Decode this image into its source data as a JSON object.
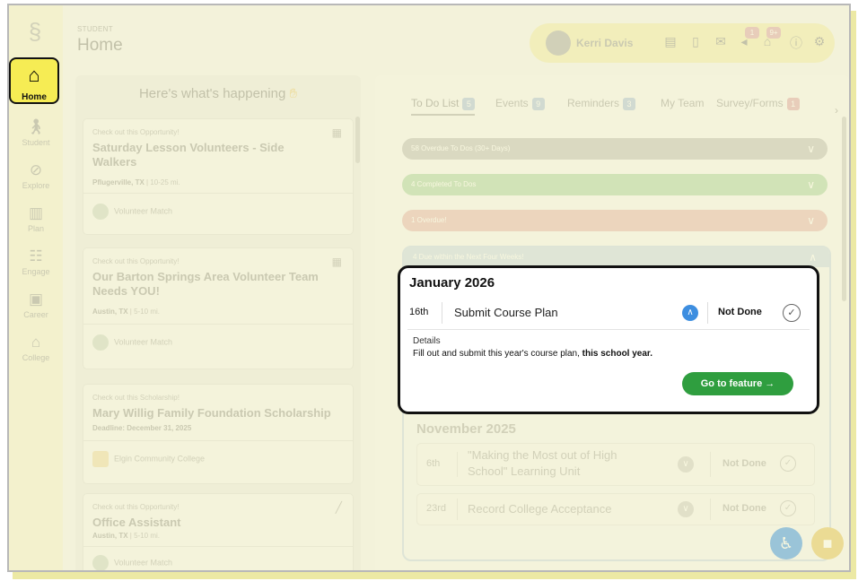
{
  "sidebar": {
    "items": [
      {
        "label": "Home",
        "icon": "home-icon"
      },
      {
        "label": "Student",
        "icon": "student-icon"
      },
      {
        "label": "Explore",
        "icon": "compass-icon"
      },
      {
        "label": "Plan",
        "icon": "map-icon"
      },
      {
        "label": "Engage",
        "icon": "handshake-icon"
      },
      {
        "label": "Career",
        "icon": "briefcase-icon"
      },
      {
        "label": "College",
        "icon": "college-icon"
      }
    ]
  },
  "header": {
    "section": "STUDENT",
    "title": "Home",
    "user_name": "Kerri Davis",
    "notif_badge_1": "1",
    "notif_badge_2": "9+"
  },
  "feed": {
    "title": "Here's what's happening",
    "cards": [
      {
        "kicker": "Check out this Opportunity!",
        "title": "Saturday Lesson Volunteers - Side Walkers",
        "meta_bold": "Pflugerville, TX",
        "meta_rest": " | 10-25 mi.",
        "source": "Volunteer Match"
      },
      {
        "kicker": "Check out this Opportunity!",
        "title": "Our Barton Springs Area Volunteer Team Needs YOU!",
        "meta_bold": "Austin, TX",
        "meta_rest": " | 5-10 mi.",
        "source": "Volunteer Match"
      },
      {
        "kicker": "Check out this Scholarship!",
        "title": "Mary Willig Family Foundation Scholarship",
        "meta_bold": "Deadline: December 31, 2025",
        "meta_rest": "",
        "source": "Elgin Community College"
      },
      {
        "kicker": "Check out this Opportunity!",
        "title": "Office Assistant",
        "meta_bold": "Austin, TX",
        "meta_rest": " | 5-10 mi.",
        "source": "Volunteer Match"
      }
    ]
  },
  "tabs": [
    {
      "label": "To Do List",
      "count": "5",
      "color": "#a8bfe0"
    },
    {
      "label": "Events",
      "count": "9",
      "color": "#a8bfe0"
    },
    {
      "label": "Reminders",
      "count": "3",
      "color": "#a8bfe0"
    },
    {
      "label": "My Team",
      "count": "",
      "color": ""
    },
    {
      "label": "Survey/Forms",
      "count": "1",
      "color": "#dca3ad"
    }
  ],
  "accordions": [
    {
      "label": "58 Overdue To Dos (30+ Days)",
      "color": "#bdbdbd"
    },
    {
      "label": "4 Completed To Dos",
      "color": "#a9d3a6"
    },
    {
      "label": "1 Overdue!",
      "color": "#e4b4b4"
    },
    {
      "label": "4 Due within the Next Four Weeks!",
      "color": "#c7d7ea"
    }
  ],
  "todo": {
    "month": "January 2026",
    "day": "16th",
    "task": "Submit Course Plan",
    "status": "Not Done",
    "details_label": "Details",
    "details_text": "Fill out and submit this year's course plan, ",
    "details_bold": "this school year.",
    "button": "Go to feature →"
  },
  "november": {
    "month": "November 2025",
    "rows": [
      {
        "day": "6th",
        "task": "\"Making the Most out of High School\" Learning Unit",
        "status": "Not Done"
      },
      {
        "day": "23rd",
        "task": "Record College Acceptance",
        "status": "Not Done"
      }
    ]
  }
}
